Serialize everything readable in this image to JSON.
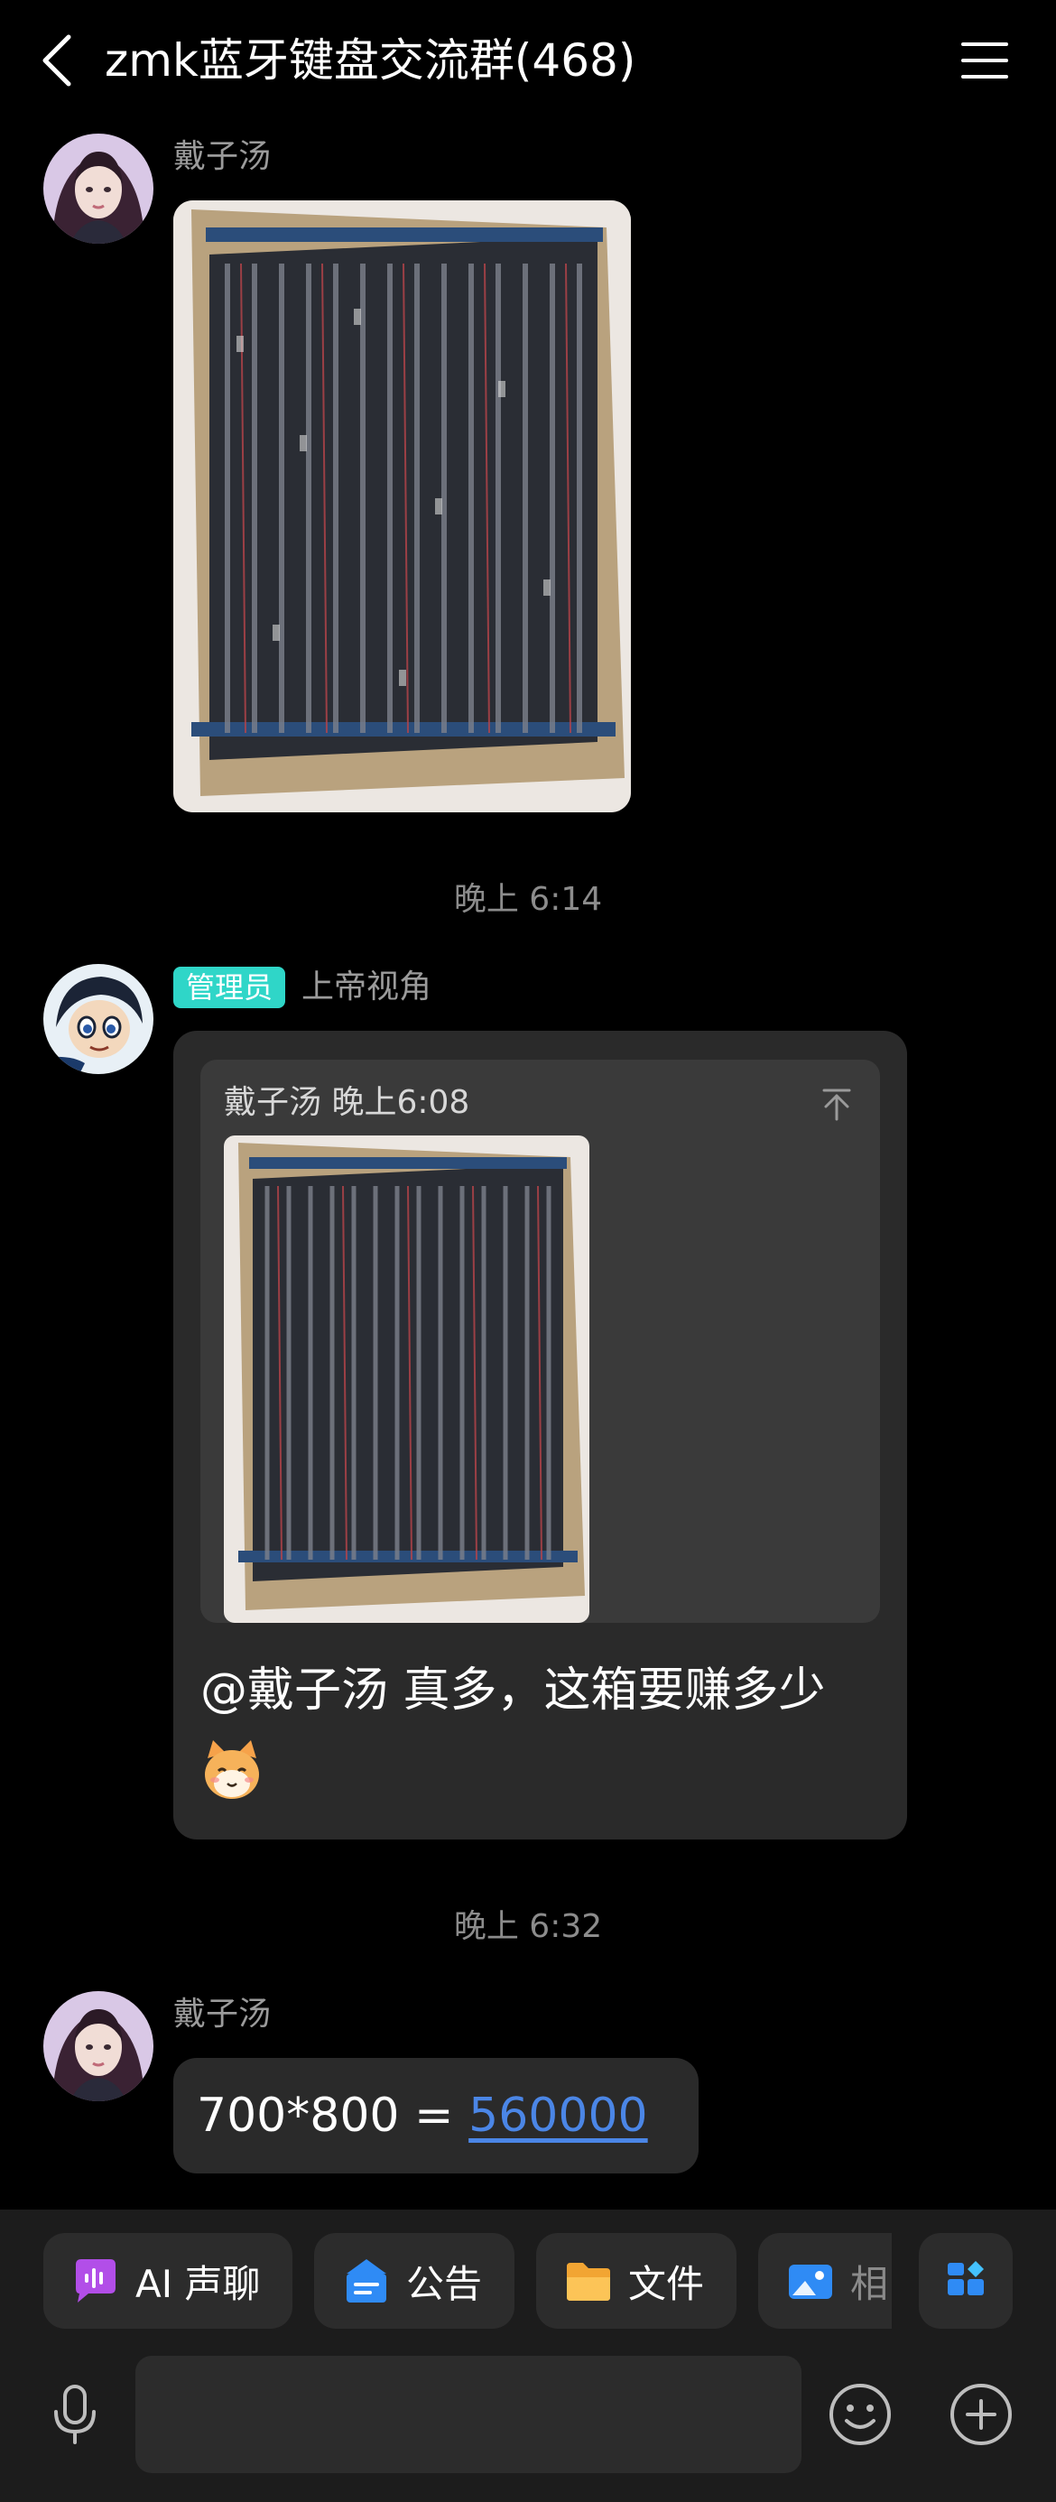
{
  "header": {
    "title": "zmk蓝牙键盘交流群(468)",
    "back_icon": "chevron-left-icon",
    "menu_icon": "hamburger-menu-icon"
  },
  "messages": [
    {
      "sender": "戴子汤",
      "type": "image"
    },
    {
      "time_separator": "晚上 6:14"
    },
    {
      "role_badge": "管理员",
      "sender": "上帝视角",
      "type": "reply",
      "quoted_sender": "戴子汤",
      "quoted_time": "晚上6:08",
      "text": "@戴子汤 真多，这箱要赚多少"
    },
    {
      "time_separator": "晚上 6:32"
    },
    {
      "sender": "戴子汤",
      "type": "text",
      "text_prefix": "700*800 = ",
      "text_link": "560000"
    }
  ],
  "toolbar": {
    "chips": [
      {
        "label": "AI 声聊",
        "icon": "ai-voice-chat-icon"
      },
      {
        "label": "公告",
        "icon": "announcement-icon"
      },
      {
        "label": "文件",
        "icon": "folder-icon"
      },
      {
        "label": "相",
        "icon": "album-icon"
      }
    ],
    "apps_icon": "apps-grid-icon"
  },
  "composer": {
    "mic_icon": "microphone-icon",
    "emoji_icon": "emoji-icon",
    "plus_icon": "plus-icon",
    "input_value": ""
  },
  "colors": {
    "background": "#000000",
    "bubble": "#2a2a2a",
    "admin_badge": "#2fd6c8",
    "link": "#4b86e6",
    "secondary_text": "#9b9b9b"
  }
}
